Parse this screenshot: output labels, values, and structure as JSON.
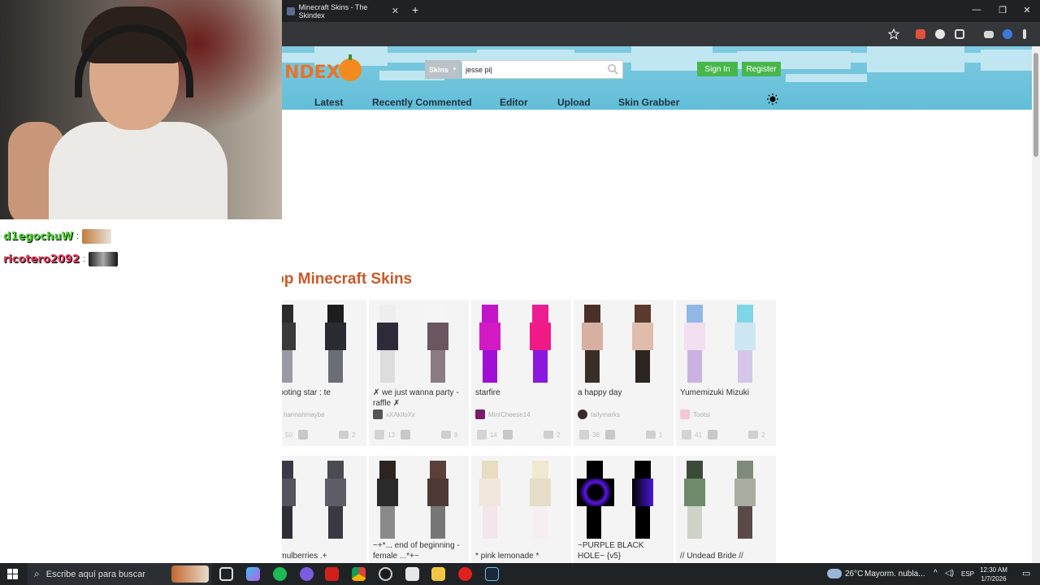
{
  "browser": {
    "tab_title": "Minecraft Skins - The Skindex",
    "tab_close": "✕",
    "new_tab": "+",
    "window_buttons": [
      "—",
      "❐",
      "✕"
    ]
  },
  "chat": [
    {
      "user": "d1egochuW",
      "sep": ":",
      "color": "#53d63b"
    },
    {
      "user": "ricotero2092",
      "sep": ":",
      "color": "#e03a57"
    }
  ],
  "site": {
    "logo_text": "NDEX",
    "search": {
      "type_label": "Skins",
      "query": "jesse pi|"
    },
    "sign_in": "Sign In",
    "register": "Register",
    "nav": [
      "Latest",
      "Recently Commented",
      "Editor",
      "Upload",
      "Skin Grabber"
    ],
    "section_title": "Top Minecraft Skins"
  },
  "skins_row1": [
    {
      "title": "shooting star : te",
      "author": "hannahmaybe",
      "likes": "50",
      "comments": "2"
    },
    {
      "title": "✗ we just wanna party - raffle ✗",
      "author": "xXAkiloXx",
      "likes": "13",
      "comments": "8"
    },
    {
      "title": "starfire",
      "author": "MintCheese14",
      "likes": "14",
      "comments": "2"
    },
    {
      "title": "a happy day",
      "author": "tailymarks",
      "likes": "38",
      "comments": "1"
    },
    {
      "title": "Yumemizuki Mizuki",
      "author": "Tootsi",
      "likes": "41",
      "comments": "2"
    }
  ],
  "skins_row2": [
    {
      "title": "+. mulberries .+"
    },
    {
      "title": "~+*... end of beginning - female ...*+~"
    },
    {
      "title": "* pink lemonade *"
    },
    {
      "title": "~PURPLE BLACK HOLE~ {v5}"
    },
    {
      "title": "// Undead Bride //"
    }
  ],
  "taskbar": {
    "search_placeholder": "Escribe aquí para buscar",
    "temperature": "26°C",
    "weather": "Mayorm. nubla...",
    "language": "ESP",
    "time": "12:30 AM",
    "date": "1/7/2026"
  },
  "colors": {
    "accent_green": "#47b74b",
    "title_orange": "#c85a28",
    "header_sky": "#62bed8"
  }
}
